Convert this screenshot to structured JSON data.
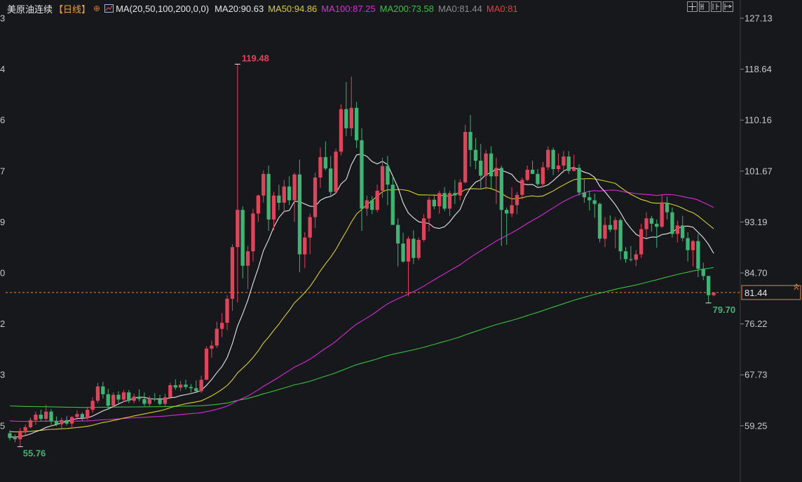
{
  "legend": {
    "symbol": "美原油连续",
    "period": "【日线】",
    "plus_icon": "plus-circle-icon",
    "indicator_icon": "chart-indicator-icon",
    "params": "MA(20,50,100,200,0,0)",
    "items": [
      {
        "label": "MA20:90.63",
        "color": "#e6e6e6"
      },
      {
        "label": "MA50:94.86",
        "color": "#d8cf2a"
      },
      {
        "label": "MA100:87.25",
        "color": "#d72bd6"
      },
      {
        "label": "MA200:73.58",
        "color": "#35c23a"
      },
      {
        "label": "MA0:81.44",
        "color": "#8c8c8c"
      },
      {
        "label": "MA0:81",
        "color": "#e0403c"
      }
    ]
  },
  "toolbar": {
    "icons": [
      "crosshair-icon",
      "layout-icon",
      "split-icon",
      "fullscreen-icon"
    ]
  },
  "left_axis_fragments": [
    "3",
    "4",
    "6",
    "7",
    "9",
    "0",
    "2",
    "3",
    "5"
  ],
  "colors": {
    "background": "#17181c",
    "up": "#e0445a",
    "down": "#3fb573",
    "ma20": "#e6e6e6",
    "ma50": "#d8cf2a",
    "ma100": "#d72bd6",
    "ma200": "#35c23a",
    "last_price": "#e98a2a"
  },
  "chart_data": {
    "type": "candlestick",
    "y_ticks": [
      "127.13",
      "118.64",
      "110.16",
      "101.67",
      "93.19",
      "84.70",
      "76.22",
      "67.73",
      "59.25"
    ],
    "ylim": [
      53.4,
      129.5
    ],
    "annotations": {
      "high": "119.48",
      "low": "55.76",
      "last_low": "79.70"
    },
    "last_price": {
      "label": "81.44",
      "value": 81.44
    },
    "candles": [
      [
        58.0,
        58.5,
        56.8,
        57.2
      ],
      [
        57.2,
        57.8,
        56.5,
        57.0
      ],
      [
        57.0,
        58.9,
        55.76,
        58.4
      ],
      [
        58.4,
        59.4,
        57.6,
        59.0
      ],
      [
        59.0,
        60.6,
        58.8,
        60.2
      ],
      [
        60.2,
        61.6,
        59.4,
        61.1
      ],
      [
        61.1,
        61.9,
        60.0,
        60.4
      ],
      [
        60.4,
        62.7,
        59.9,
        61.6
      ],
      [
        61.6,
        62.0,
        59.4,
        60.0
      ],
      [
        60.0,
        60.8,
        59.2,
        59.5
      ],
      [
        59.5,
        60.6,
        58.6,
        60.2
      ],
      [
        60.2,
        60.9,
        59.3,
        59.6
      ],
      [
        59.6,
        60.8,
        59.0,
        60.7
      ],
      [
        60.7,
        61.8,
        60.2,
        61.2
      ],
      [
        61.2,
        61.5,
        60.0,
        60.5
      ],
      [
        60.5,
        62.4,
        60.2,
        61.9
      ],
      [
        61.9,
        64.0,
        61.4,
        63.4
      ],
      [
        63.4,
        66.4,
        63.0,
        65.8
      ],
      [
        65.8,
        66.6,
        63.8,
        64.5
      ],
      [
        64.5,
        65.4,
        61.9,
        62.6
      ],
      [
        62.6,
        64.8,
        62.3,
        64.4
      ],
      [
        64.4,
        65.0,
        63.0,
        63.6
      ],
      [
        63.6,
        65.2,
        63.2,
        64.8
      ],
      [
        64.8,
        65.2,
        63.0,
        63.4
      ],
      [
        63.4,
        64.6,
        63.0,
        64.1
      ],
      [
        64.1,
        65.3,
        63.3,
        63.7
      ],
      [
        63.7,
        64.8,
        62.5,
        62.9
      ],
      [
        62.9,
        64.2,
        62.5,
        63.8
      ],
      [
        63.8,
        64.7,
        63.3,
        63.6
      ],
      [
        63.6,
        64.4,
        62.6,
        62.9
      ],
      [
        62.9,
        64.6,
        62.5,
        64.0
      ],
      [
        64.0,
        66.4,
        63.7,
        66.0
      ],
      [
        66.0,
        67.0,
        65.2,
        65.6
      ],
      [
        65.6,
        66.7,
        65.0,
        66.1
      ],
      [
        66.1,
        66.9,
        65.3,
        65.7
      ],
      [
        65.7,
        66.2,
        64.8,
        65.5
      ],
      [
        65.5,
        66.8,
        64.9,
        65.0
      ],
      [
        65.0,
        67.6,
        64.7,
        66.9
      ],
      [
        66.9,
        72.5,
        69.2,
        72.1
      ],
      [
        72.1,
        73.4,
        70.6,
        72.6
      ],
      [
        72.6,
        76.6,
        72.2,
        75.4
      ],
      [
        75.4,
        78.0,
        74.0,
        76.4
      ],
      [
        76.4,
        81.0,
        75.2,
        80.4
      ],
      [
        80.4,
        89.5,
        78.4,
        89.0
      ],
      [
        89.0,
        119.48,
        79.8,
        95.2
      ],
      [
        95.2,
        95.8,
        83.8,
        85.9
      ],
      [
        85.9,
        89.2,
        82.0,
        88.3
      ],
      [
        88.3,
        95.4,
        86.6,
        94.6
      ],
      [
        94.6,
        97.8,
        93.2,
        97.6
      ],
      [
        97.6,
        101.8,
        96.4,
        101.2
      ],
      [
        101.2,
        102.6,
        91.7,
        93.6
      ],
      [
        93.6,
        98.2,
        91.8,
        97.6
      ],
      [
        97.6,
        99.4,
        95.2,
        96.4
      ],
      [
        96.4,
        100.2,
        94.7,
        99.1
      ],
      [
        99.1,
        100.8,
        96.0,
        96.8
      ],
      [
        96.8,
        101.4,
        93.2,
        101.1
      ],
      [
        101.1,
        103.6,
        84.8,
        87.8
      ],
      [
        87.8,
        91.5,
        85.5,
        90.6
      ],
      [
        90.6,
        94.6,
        87.8,
        94.0
      ],
      [
        94.0,
        101.4,
        92.2,
        100.6
      ],
      [
        100.6,
        105.6,
        98.9,
        104.0
      ],
      [
        104.0,
        106.6,
        101.8,
        102.1
      ],
      [
        102.1,
        104.2,
        97.4,
        98.2
      ],
      [
        98.2,
        105.4,
        97.9,
        104.9
      ],
      [
        104.9,
        112.8,
        104.3,
        112.0
      ],
      [
        112.0,
        116.5,
        107.5,
        108.8
      ],
      [
        108.8,
        117.4,
        107.5,
        112.2
      ],
      [
        112.2,
        113.2,
        105.5,
        106.8
      ],
      [
        106.8,
        108.8,
        91.7,
        95.4
      ],
      [
        95.4,
        97.6,
        94.2,
        96.8
      ],
      [
        96.8,
        97.5,
        94.5,
        95.2
      ],
      [
        95.2,
        99.4,
        94.8,
        98.4
      ],
      [
        98.4,
        103.9,
        97.2,
        102.5
      ],
      [
        102.5,
        104.2,
        96.0,
        99.4
      ],
      [
        99.4,
        100.8,
        93.0,
        92.7
      ],
      [
        92.7,
        93.8,
        85.8,
        89.6
      ],
      [
        89.6,
        91.4,
        86.4,
        86.6
      ],
      [
        86.6,
        90.8,
        80.8,
        90.4
      ],
      [
        90.4,
        91.8,
        86.2,
        87.2
      ],
      [
        87.2,
        90.6,
        86.8,
        90.2
      ],
      [
        90.2,
        94.5,
        89.9,
        93.8
      ],
      [
        93.8,
        97.4,
        91.6,
        96.9
      ],
      [
        96.9,
        97.8,
        95.3,
        95.8
      ],
      [
        95.8,
        98.4,
        94.6,
        98.0
      ],
      [
        98.0,
        99.0,
        95.0,
        95.4
      ],
      [
        95.4,
        98.4,
        94.2,
        98.0
      ],
      [
        98.0,
        100.2,
        96.2,
        97.6
      ],
      [
        97.6,
        100.3,
        96.8,
        99.8
      ],
      [
        99.8,
        109.4,
        99.6,
        108.2
      ],
      [
        108.2,
        111.0,
        102.4,
        105.2
      ],
      [
        105.2,
        107.2,
        102.0,
        103.4
      ],
      [
        103.4,
        106.2,
        98.6,
        100.9
      ],
      [
        100.9,
        105.2,
        98.6,
        104.6
      ],
      [
        104.6,
        105.8,
        98.6,
        100.8
      ],
      [
        100.8,
        103.9,
        96.2,
        102.2
      ],
      [
        102.2,
        102.6,
        89.2,
        95.2
      ],
      [
        95.2,
        95.6,
        89.4,
        94.6
      ],
      [
        94.6,
        99.0,
        94.0,
        96.0
      ],
      [
        96.0,
        98.2,
        94.5,
        97.7
      ],
      [
        97.7,
        100.6,
        97.0,
        100.2
      ],
      [
        100.2,
        102.6,
        100.0,
        101.9
      ],
      [
        101.9,
        103.4,
        101.6,
        101.2
      ],
      [
        101.2,
        102.0,
        99.2,
        99.5
      ],
      [
        99.5,
        103.2,
        99.0,
        102.3
      ],
      [
        102.3,
        105.8,
        101.8,
        105.2
      ],
      [
        105.2,
        105.6,
        101.0,
        102.0
      ],
      [
        102.0,
        104.6,
        101.5,
        102.6
      ],
      [
        102.6,
        105.0,
        101.4,
        104.1
      ],
      [
        104.1,
        105.0,
        101.2,
        101.7
      ],
      [
        101.7,
        104.4,
        101.6,
        102.2
      ],
      [
        102.2,
        102.8,
        97.6,
        98.1
      ],
      [
        98.1,
        100.4,
        96.4,
        97.3
      ],
      [
        97.3,
        98.4,
        95.1,
        96.8
      ],
      [
        96.8,
        97.9,
        93.9,
        96.2
      ],
      [
        96.2,
        96.4,
        89.8,
        90.4
      ],
      [
        90.4,
        94.0,
        89.0,
        92.7
      ],
      [
        92.7,
        94.3,
        91.5,
        91.9
      ],
      [
        91.9,
        94.0,
        88.8,
        93.5
      ],
      [
        93.5,
        93.8,
        86.9,
        88.3
      ],
      [
        88.3,
        89.0,
        86.4,
        87.0
      ],
      [
        87.0,
        89.2,
        86.6,
        86.9
      ],
      [
        86.9,
        88.5,
        85.8,
        87.8
      ],
      [
        87.8,
        92.9,
        87.2,
        92.0
      ],
      [
        92.0,
        94.8,
        90.6,
        93.8
      ],
      [
        93.8,
        94.2,
        91.6,
        92.9
      ],
      [
        92.9,
        93.6,
        88.9,
        92.4
      ],
      [
        92.4,
        97.8,
        92.2,
        96.4
      ],
      [
        96.4,
        97.4,
        93.6,
        94.8
      ],
      [
        94.8,
        95.6,
        90.6,
        91.2
      ],
      [
        91.2,
        93.4,
        89.8,
        92.6
      ],
      [
        92.6,
        94.2,
        90.0,
        90.5
      ],
      [
        90.5,
        91.5,
        86.6,
        88.5
      ],
      [
        88.5,
        90.2,
        85.8,
        90.0
      ],
      [
        90.0,
        91.2,
        84.0,
        85.4
      ],
      [
        85.4,
        86.4,
        83.5,
        84.2
      ],
      [
        84.2,
        82.2,
        79.7,
        81.0
      ],
      [
        81.0,
        81.44,
        80.8,
        81.44
      ]
    ],
    "series": [
      {
        "name": "MA20",
        "y_start": 57.4,
        "y_end": 89.5
      },
      {
        "name": "MA50",
        "y_start": 58.3,
        "y_end": 94.86
      },
      {
        "name": "MA100",
        "y_start": 60.1,
        "y_end": 87.25
      },
      {
        "name": "MA200",
        "y_start": 62.6,
        "y_end": 73.58
      }
    ]
  }
}
